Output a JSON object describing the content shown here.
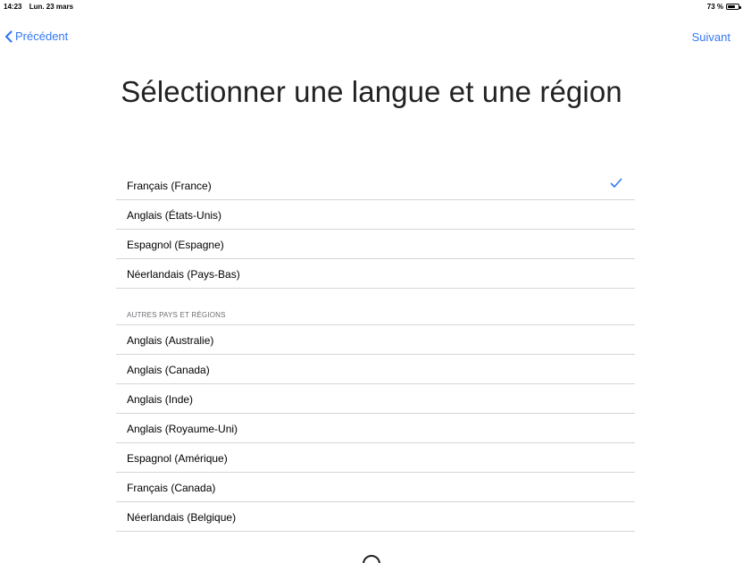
{
  "status_bar": {
    "time": "14:23",
    "date": "Lun. 23 mars",
    "battery_text": "73 %",
    "battery_level": 0.73
  },
  "nav": {
    "back_label": "Précédent",
    "next_label": "Suivant",
    "accent_color": "#3478f6"
  },
  "page": {
    "title": "Sélectionner une langue et une région"
  },
  "primary_list": {
    "items": [
      {
        "label": "Français (France)",
        "selected": true
      },
      {
        "label": "Anglais (États-Unis)",
        "selected": false
      },
      {
        "label": "Espagnol (Espagne)",
        "selected": false
      },
      {
        "label": "Néerlandais (Pays-Bas)",
        "selected": false
      }
    ]
  },
  "other_list": {
    "header": "AUTRES PAYS ET RÉGIONS",
    "items": [
      {
        "label": "Anglais (Australie)"
      },
      {
        "label": "Anglais (Canada)"
      },
      {
        "label": "Anglais (Inde)"
      },
      {
        "label": "Anglais (Royaume-Uni)"
      },
      {
        "label": "Espagnol (Amérique)"
      },
      {
        "label": "Français (Canada)"
      },
      {
        "label": "Néerlandais (Belgique)"
      }
    ]
  },
  "icons": {
    "back": "chevron-left-icon",
    "check": "checkmark-icon",
    "battery": "battery-icon"
  }
}
